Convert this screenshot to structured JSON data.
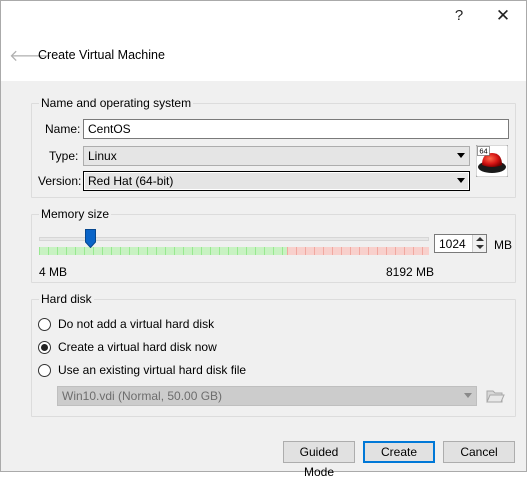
{
  "titlebar": {
    "help_label": "?",
    "close_label": "✕"
  },
  "dialog": {
    "title": "Create Virtual Machine"
  },
  "name_os": {
    "group_title": "Name and operating system",
    "name_label": "Name:",
    "name_value": "CentOS",
    "type_label": "Type:",
    "type_value": "Linux",
    "version_label": "Version:",
    "version_value": "Red Hat (64-bit)",
    "os_icon": "redhat-64bit-icon",
    "os_badge": "64"
  },
  "memory": {
    "group_title": "Memory size",
    "value": "1024",
    "unit": "MB",
    "min_label": "4 MB",
    "max_label": "8192 MB",
    "slider_value_mb": 1024,
    "slider_min_mb": 4,
    "slider_max_mb": 8192
  },
  "hard_disk": {
    "group_title": "Hard disk",
    "options": [
      {
        "label": "Do not add a virtual hard disk",
        "checked": false
      },
      {
        "label": "Create a virtual hard disk now",
        "checked": true
      },
      {
        "label": "Use an existing virtual hard disk file",
        "checked": false
      }
    ],
    "existing_file": "Win10.vdi (Normal, 50.00 GB)",
    "folder_icon": "folder-open-icon"
  },
  "buttons": {
    "guided_mode": "Guided Mode",
    "create": "Create",
    "cancel": "Cancel"
  },
  "colors": {
    "slider_green": "#c8f2c2",
    "slider_red": "#f8d0cc",
    "slider_thumb": "#0a64c8",
    "default_button_border": "#0078d7"
  }
}
